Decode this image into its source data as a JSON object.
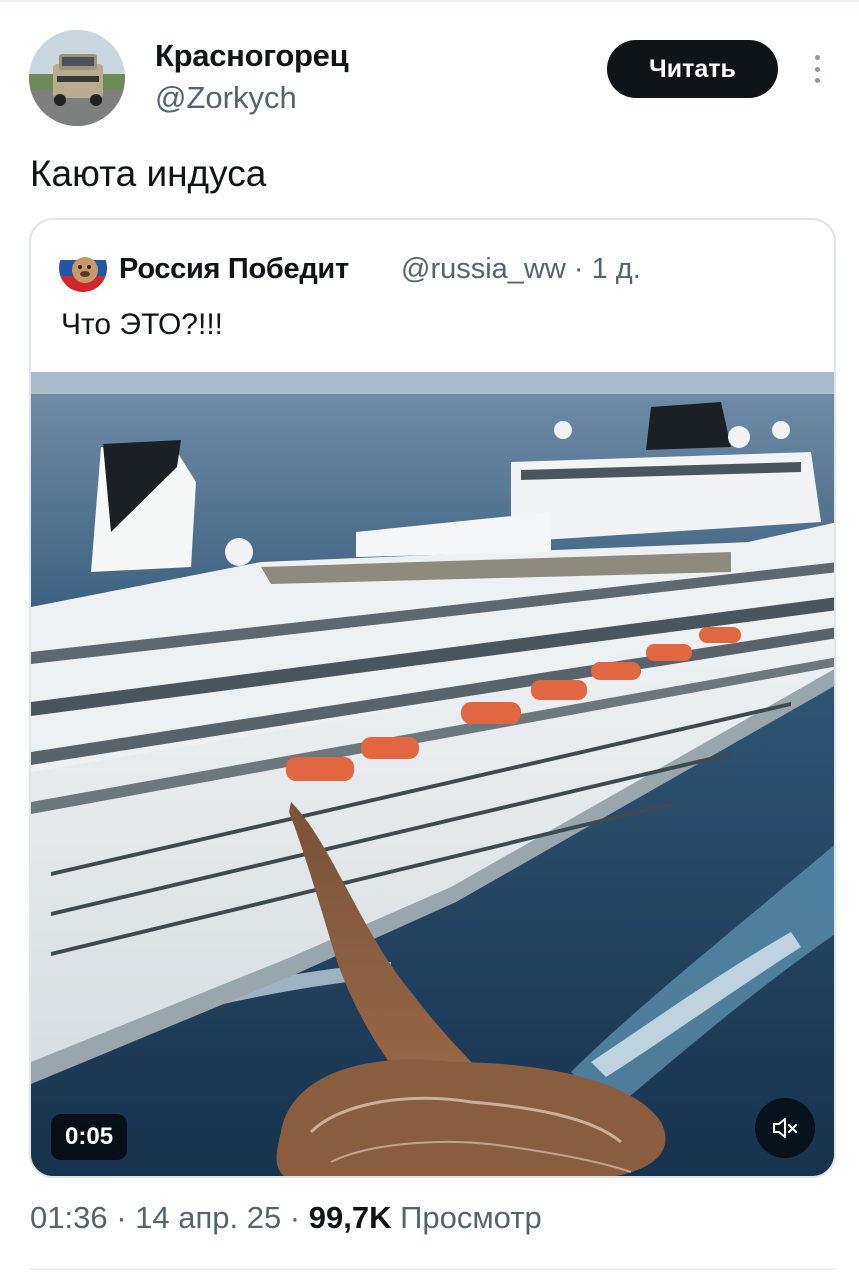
{
  "author": {
    "display_name": "Красногорец",
    "handle": "@Zorkych",
    "follow_label": "Читать"
  },
  "tweet": {
    "text": "Каюта индуса"
  },
  "quoted": {
    "display_name": "Россия Победит",
    "handle_time": "@russia_ww · 1 д.",
    "text": "Что ЭТО?!!!",
    "video": {
      "duration": "0:05",
      "mute_icon": "speaker-muted-icon"
    }
  },
  "meta": {
    "time_date": "01:36 · 14 апр. 25 · ",
    "views_count": "99,7K",
    "views_label": "Просмотр"
  },
  "colors": {
    "text_primary": "#0f1419",
    "text_secondary": "#536471",
    "border": "#dfe5e8",
    "button_bg": "#0f1419"
  }
}
